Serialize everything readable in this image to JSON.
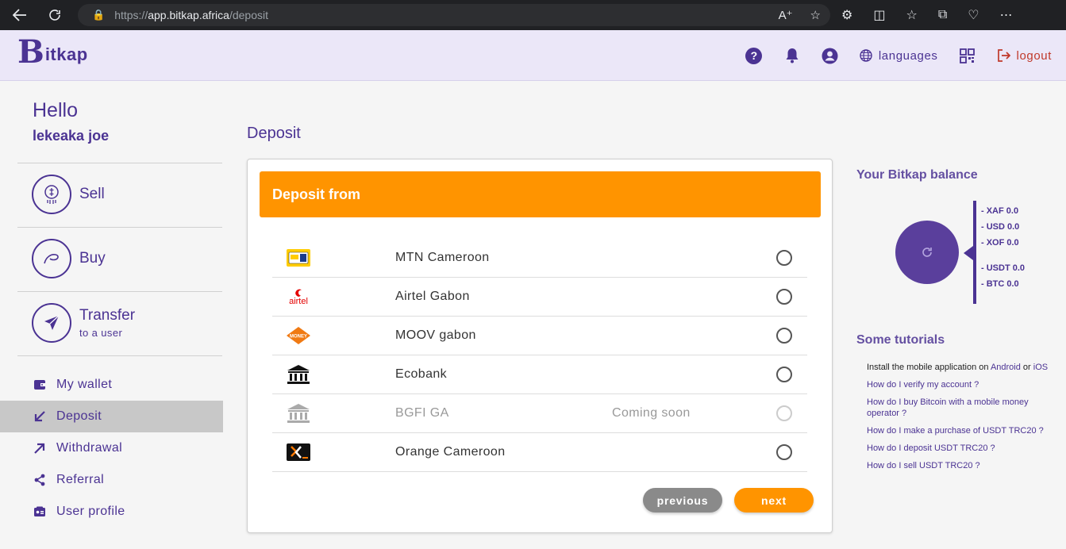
{
  "browser": {
    "url_prefix": "https://",
    "url_host": "app.bitkap.africa",
    "url_path": "/deposit"
  },
  "header": {
    "logo_letter": "B",
    "logo_text": "itkap",
    "languages_label": "languages",
    "logout_label": "logout"
  },
  "sidebar": {
    "greeting": "Hello",
    "username": "lekeaka joe",
    "big_items": [
      {
        "label": "Sell",
        "sub": ""
      },
      {
        "label": "Buy",
        "sub": ""
      },
      {
        "label": "Transfer",
        "sub": "to a user"
      }
    ],
    "menu": [
      {
        "label": "My wallet",
        "icon": "wallet-icon"
      },
      {
        "label": "Deposit",
        "icon": "arrow-down-left-icon"
      },
      {
        "label": "Withdrawal",
        "icon": "arrow-up-right-icon"
      },
      {
        "label": "Referral",
        "icon": "share-icon"
      },
      {
        "label": "User profile",
        "icon": "id-card-icon"
      }
    ]
  },
  "main": {
    "title": "Deposit",
    "card_title": "Deposit from",
    "methods": [
      {
        "name": "MTN Cameroon",
        "status": "",
        "enabled": true
      },
      {
        "name": "Airtel Gabon",
        "status": "",
        "enabled": true
      },
      {
        "name": "MOOV gabon",
        "status": "",
        "enabled": true
      },
      {
        "name": "Ecobank",
        "status": "",
        "enabled": true
      },
      {
        "name": "BGFI GA",
        "status": "Coming soon",
        "enabled": false
      },
      {
        "name": "Orange Cameroon",
        "status": "",
        "enabled": true
      }
    ],
    "previous_label": "previous",
    "next_label": "next",
    "logo_labels": {
      "airtel": "airtel",
      "moov": "MONEY"
    }
  },
  "right": {
    "balance_title": "Your Bitkap balance",
    "balances": [
      "- XAF 0.0",
      "- USD 0.0",
      "- XOF 0.0",
      "- USDT 0.0",
      "- BTC 0.0"
    ],
    "tutorials_title": "Some tutorials",
    "install_prefix": "Install the mobile application on ",
    "install_android": "Android",
    "install_or": " or ",
    "install_ios": "iOS",
    "tutorials": [
      "How do I verify my account ?",
      "How do I buy Bitcoin with a mobile money operator ?",
      "How do I make a purchase of USDT TRC20 ?",
      "How do I deposit USDT TRC20 ?",
      "How do I sell USDT TRC20 ?"
    ]
  },
  "colors": {
    "brand_purple": "#4b3393",
    "accent_orange": "#ff9400",
    "logout_red": "#c0392b"
  }
}
